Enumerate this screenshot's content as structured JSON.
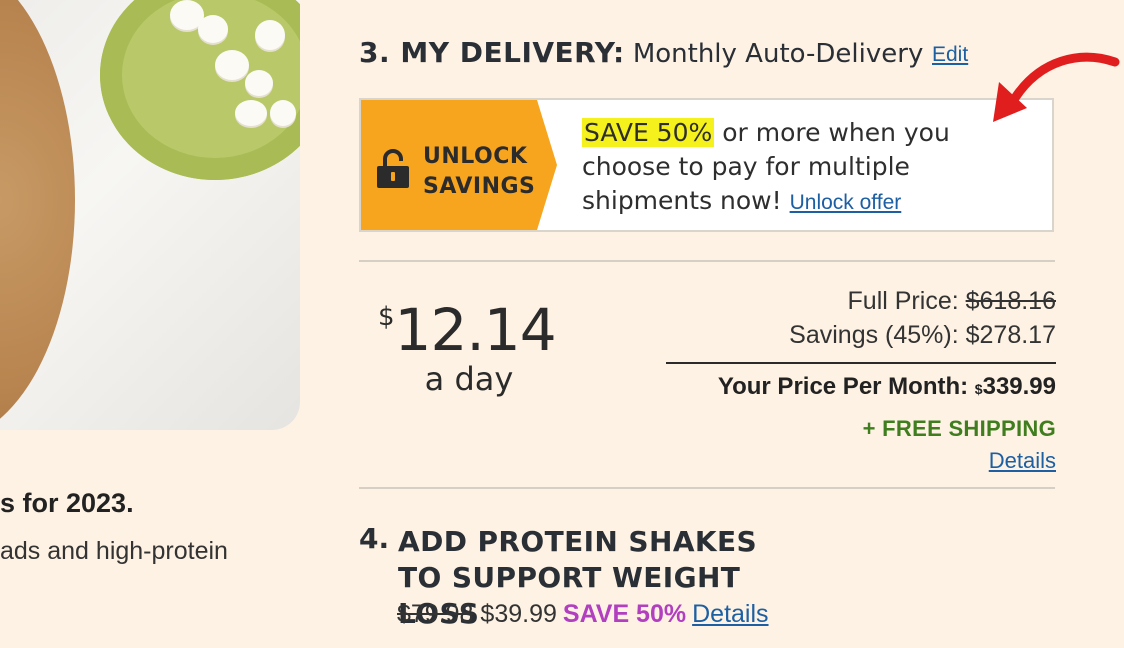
{
  "step3": {
    "label": "3. MY DELIVERY:",
    "value": "Monthly Auto-Delivery",
    "edit_label": "Edit"
  },
  "promo": {
    "tag_line1": "UNLOCK",
    "tag_line2": "SAVINGS",
    "highlight": "SAVE 50%",
    "text": " or more when you choose to pay for multiple shipments now! ",
    "link_label": "Unlock offer"
  },
  "price": {
    "currency": "$",
    "per_day_amount": "12.14",
    "per_day_label": "a day",
    "full_price_label": "Full Price: ",
    "full_price_value": "$618.16",
    "savings_label": "Savings (45%): ",
    "savings_value": "$278.17",
    "your_price_label": "Your Price Per Month: ",
    "your_price_currency": "$",
    "your_price_value": "339.99",
    "free_shipping": "+ FREE SHIPPING",
    "details_label": "Details"
  },
  "step4": {
    "number": "4.",
    "title_line1": "ADD PROTEIN SHAKES",
    "title_line2": "TO SUPPORT WEIGHT LOSS",
    "old_price": "$79.98",
    "new_price": "$39.99",
    "save_label": "SAVE 50%",
    "details_label": "Details"
  },
  "left_fragment": {
    "line1": "s for 2023.",
    "line2": "ads and high-protein"
  },
  "colors": {
    "background": "#fdf2e3",
    "accent_orange": "#f7a51e",
    "highlight_yellow": "#f5f11c",
    "link_blue": "#1d5fa3",
    "shipping_green": "#3f7d1f",
    "save_purple": "#b13fc0",
    "arrow_red": "#e01e1e"
  },
  "icons": {
    "lock": "lock-icon",
    "arrow": "red-arrow-icon"
  }
}
